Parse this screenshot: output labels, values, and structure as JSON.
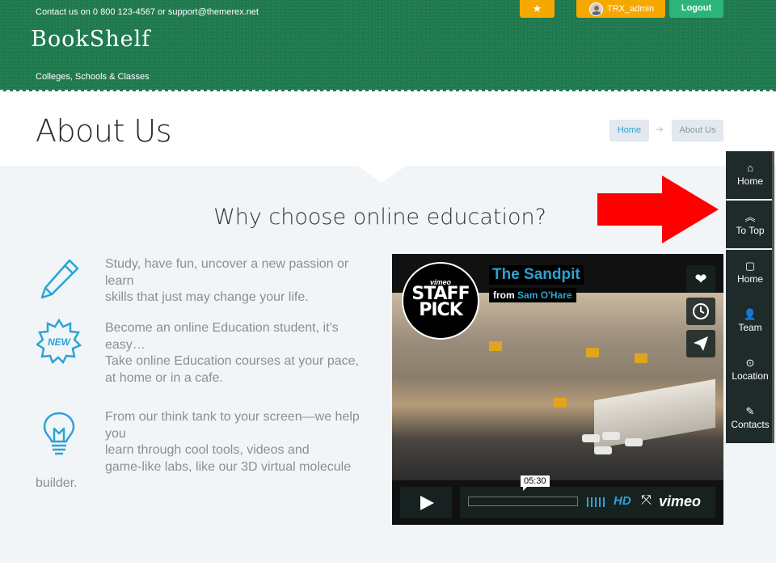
{
  "header": {
    "contact_text": "Contact us on 0 800 123-4567 or support@themerex.net",
    "logo": "BookShelf",
    "tagline": "Colleges, Schools & Classes",
    "star_icon": "star-icon",
    "user_name": "TRX_admin",
    "logout_label": "Logout",
    "colors": {
      "header_bg": "#1f7a4f",
      "orange": "#f6a800",
      "green_button": "#2bb57b"
    }
  },
  "title_bar": {
    "title": "About Us",
    "breadcrumb": {
      "home": "Home",
      "arrow": "➔",
      "current": "About Us"
    }
  },
  "section": {
    "heading": "Why choose online education?",
    "features": [
      {
        "icon": "pencil-icon",
        "lines": [
          "Study, have fun, uncover a new passion or",
          "learn",
          "skills that just may change your life."
        ]
      },
      {
        "icon": "new-badge-icon",
        "lines": [
          "Become an online Education student, it’s",
          "easy…",
          "Take online Education courses at your pace,",
          "at home or in a cafe."
        ]
      },
      {
        "icon": "lightbulb-icon",
        "lines": [
          "From our think tank to your screen—we help",
          "you",
          "learn through cool tools, videos and",
          "game-like labs, like our 3D virtual molecule"
        ],
        "continuation": "builder."
      }
    ]
  },
  "video": {
    "badge": {
      "top": "vimeo",
      "line1": "STAFF",
      "line2": "PICK"
    },
    "title": "The Sandpit",
    "from_prefix": "from",
    "author": "Sam O'Hare",
    "time": "05:30",
    "hd_label": "HD",
    "brand": "vimeo",
    "side_buttons": [
      "heart-icon",
      "clock-icon",
      "paper-plane-icon"
    ]
  },
  "toolbar": {
    "items": [
      {
        "label": "Home",
        "icon": "home-icon"
      },
      {
        "label": "To Top",
        "icon": "chevron-up-icon"
      },
      {
        "label": "Home",
        "icon": "comment-icon"
      },
      {
        "label": "Team",
        "icon": "add-user-icon"
      },
      {
        "label": "Location",
        "icon": "map-pin-icon"
      },
      {
        "label": "Contacts",
        "icon": "pencil-icon"
      }
    ]
  }
}
